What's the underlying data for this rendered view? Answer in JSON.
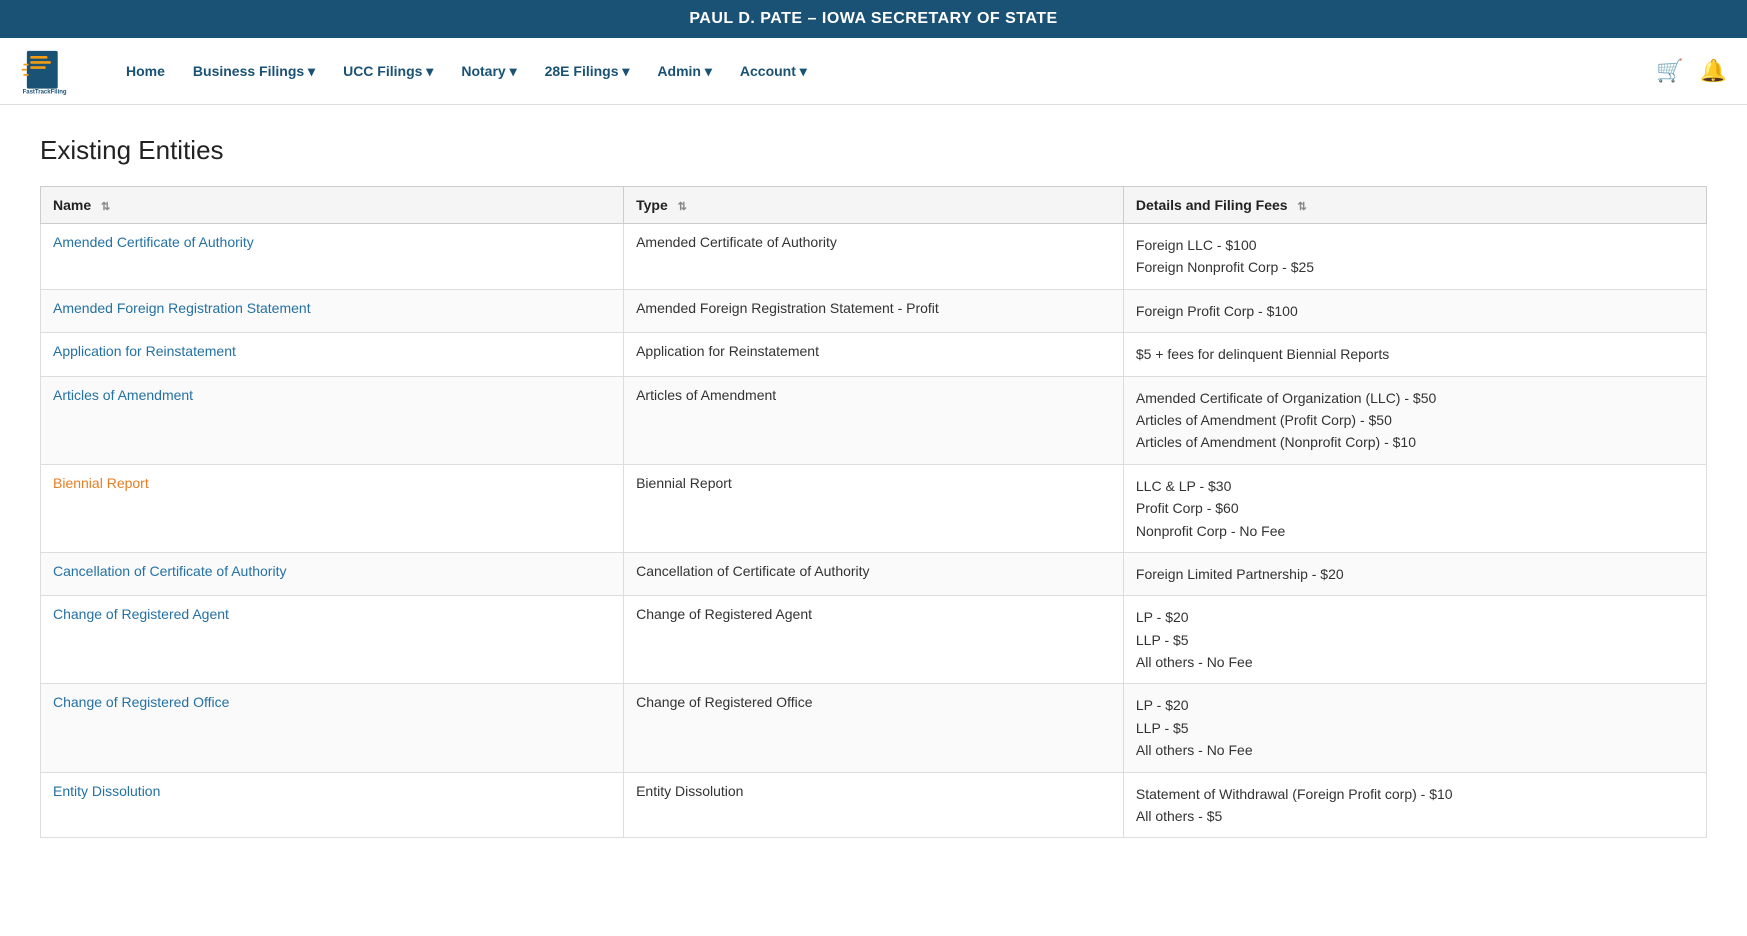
{
  "banner": {
    "title": "PAUL D. PATE – IOWA SECRETARY OF STATE"
  },
  "nav": {
    "logo_alt": "FastTrackFiling",
    "items": [
      {
        "label": "Home",
        "dropdown": false
      },
      {
        "label": "Business Filings ▾",
        "dropdown": true
      },
      {
        "label": "UCC Filings ▾",
        "dropdown": true
      },
      {
        "label": "Notary ▾",
        "dropdown": true
      },
      {
        "label": "28E Filings ▾",
        "dropdown": true
      },
      {
        "label": "Admin ▾",
        "dropdown": true
      },
      {
        "label": "Account ▾",
        "dropdown": true
      }
    ]
  },
  "page": {
    "title": "Existing Entities"
  },
  "table": {
    "columns": [
      "Name",
      "Type",
      "Details and Filing Fees"
    ],
    "rows": [
      {
        "name": "Amended Certificate of Authority",
        "name_link": "blue",
        "type": "Amended Certificate of Authority",
        "details": [
          "Foreign LLC - $100",
          "Foreign Nonprofit Corp - $25"
        ]
      },
      {
        "name": "Amended Foreign Registration Statement",
        "name_link": "blue",
        "type": "Amended Foreign Registration Statement - Profit",
        "details": [
          "Foreign Profit Corp - $100"
        ]
      },
      {
        "name": "Application for Reinstatement",
        "name_link": "blue",
        "type": "Application for Reinstatement",
        "details": [
          "$5 + fees for delinquent Biennial Reports"
        ]
      },
      {
        "name": "Articles of Amendment",
        "name_link": "blue",
        "type": "Articles of Amendment",
        "details": [
          "Amended Certificate of Organization (LLC) - $50",
          "Articles of Amendment (Profit Corp) - $50",
          "Articles of Amendment (Nonprofit Corp) - $10"
        ]
      },
      {
        "name": "Biennial Report",
        "name_link": "orange",
        "type": "Biennial Report",
        "details": [
          "LLC & LP - $30",
          "Profit Corp - $60",
          "Nonprofit Corp - No Fee"
        ]
      },
      {
        "name": "Cancellation of Certificate of Authority",
        "name_link": "blue",
        "type": "Cancellation of Certificate of Authority",
        "details": [
          "Foreign Limited Partnership - $20"
        ]
      },
      {
        "name": "Change of Registered Agent",
        "name_link": "blue",
        "type": "Change of Registered Agent",
        "details": [
          "LP - $20",
          "LLP - $5",
          "All others - No Fee"
        ]
      },
      {
        "name": "Change of Registered Office",
        "name_link": "blue",
        "type": "Change of Registered Office",
        "details": [
          "LP - $20",
          "LLP - $5",
          "All others - No Fee"
        ]
      },
      {
        "name": "Entity Dissolution",
        "name_link": "blue",
        "type": "Entity Dissolution",
        "details": [
          "Statement of Withdrawal (Foreign Profit corp) - $10",
          "All others - $5"
        ]
      }
    ]
  }
}
